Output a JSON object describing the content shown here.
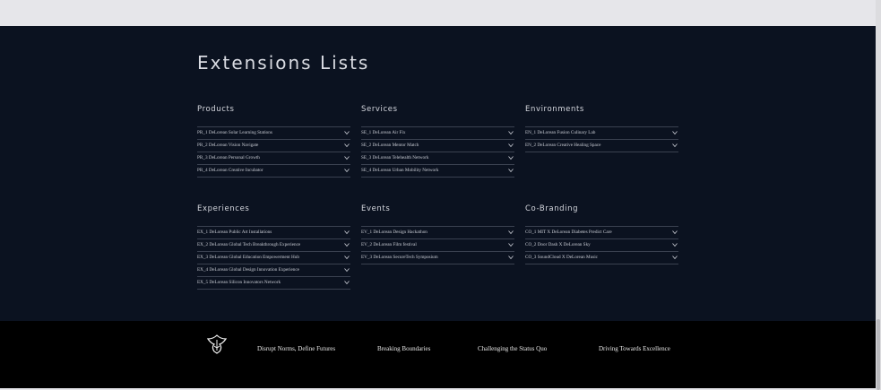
{
  "page": {
    "title": "Extensions Lists"
  },
  "sections": [
    {
      "id": "products",
      "title": "Products",
      "items": [
        "PR_1 DeLorean Solar Learning Stations",
        "PR_2 DeLorean Vision Navigate",
        "PR_3 DeLorean Personal Growth",
        "PR_4 DeLorean Creative Incubator"
      ]
    },
    {
      "id": "services",
      "title": "Services",
      "items": [
        "SE_1 DeLorean Air Fix",
        "SE_2 DeLorean Mentor Match",
        "SE_3 DeLorean Telehealth Network",
        "SE_4 DeLorean Urban Mobility Network"
      ]
    },
    {
      "id": "environments",
      "title": "Environments",
      "items": [
        "EN_1 DeLorean Fusion Culinary Lab",
        "EN_2 DeLorean Creative Healing Space"
      ]
    },
    {
      "id": "experiences",
      "title": "Experiences",
      "items": [
        "EX_1 DeLorean Public Art Installations",
        "EX_2 DeLorean Global Tech Breakthrough Experience",
        "EX_3 DeLorean Global Education Empowerment Hub",
        "EX_4 DeLorean Global Design Innovation Experience",
        "EX_5 DeLorean Silicon Innovators Network"
      ]
    },
    {
      "id": "events",
      "title": "Events",
      "items": [
        "EV_1 DeLorean Design Hackathon",
        "EV_2 DeLorean Film festival",
        "EV_3 DeLorean SecureTech Symposium"
      ]
    },
    {
      "id": "co-branding",
      "title": "Co-Branding",
      "items": [
        "CO_1 MIT X DeLorean Diabetes Predict Care",
        "CO_2 Door Dash X DeLorean Sky",
        "CO_3 SoundCloud X DeLorean Music"
      ]
    }
  ],
  "footer": {
    "links": [
      "Disrupt Norms, Define Futures",
      "Breaking Boundaries",
      "Challenging the Status Quo",
      "Driving Towards Excellence"
    ]
  },
  "icons": {
    "row_toggle": "chevron-down-icon",
    "logo": "phoenix-logo-icon"
  },
  "colors": {
    "main_bg": "#0b1220",
    "footer_bg": "#000000",
    "text": "#d4d6dd",
    "divider": "#3a4150"
  }
}
